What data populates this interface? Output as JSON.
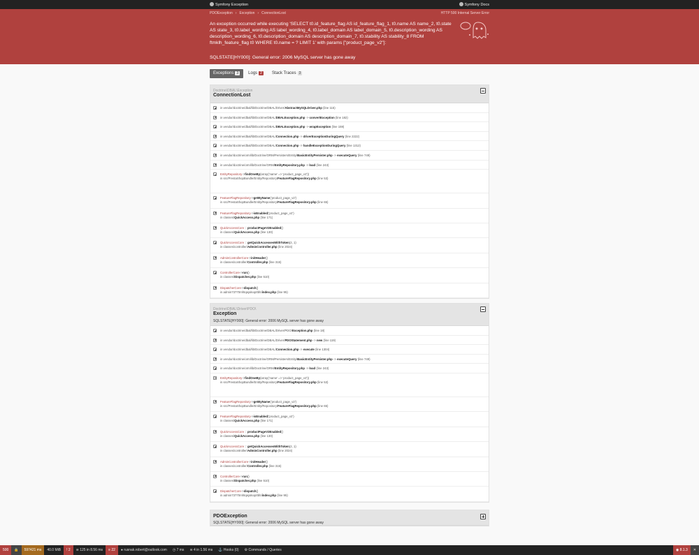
{
  "topbar": {
    "brand": "Symfony Exception",
    "docs": "Symfony Docs"
  },
  "header": {
    "crumbs": [
      "PDOException",
      "Exception",
      "ConnectionLost"
    ],
    "status": "HTTP 500 Internal Server Error",
    "message": "An exception occurred while executing 'SELECT t0.id_feature_flag AS id_feature_flag_1, t0.name AS name_2, t0.state AS state_3, t0.label_wording AS label_wording_4, t0.label_domain AS label_domain_5, t0.description_wording AS description_wording_6, t0.description_domain AS description_domain_7, t0.stability AS stability_8 FROM ftmklh_feature_flag t0 WHERE t0.name = ? LIMIT 1' with params [\"product_page_v2\"]:",
    "error": "SQLSTATE[HY000]: General error: 2006 MySQL server has gone away"
  },
  "tabs": [
    {
      "label": "Exceptions",
      "count": "3"
    },
    {
      "label": "Logs",
      "count": "2"
    },
    {
      "label": "Stack Traces",
      "count": "3"
    }
  ],
  "sections": [
    {
      "cls": "Doctrine\\DBAL\\Exception",
      "title": "ConnectionLost",
      "message": "",
      "rows": [
        {
          "kind": "vendor",
          "pre": "in vendor/doctrine/dbal/lib/Doctrine/DBAL/Driver/",
          "file": "AbstractMySQLDriver.php",
          "fn": "",
          "ln": "(line 115)"
        },
        {
          "kind": "vendor",
          "pre": "in vendor/doctrine/dbal/lib/Doctrine/DBAL/",
          "file": "DBALException.php",
          "fn": "convertException",
          "ln": "(line 182)"
        },
        {
          "kind": "vendor",
          "pre": "in vendor/doctrine/dbal/lib/Doctrine/DBAL/",
          "file": "DBALException.php",
          "fn": "wrapException",
          "ln": "(line 159)"
        },
        {
          "kind": "vendor",
          "pre": "in vendor/doctrine/dbal/lib/Doctrine/DBAL/",
          "file": "Connection.php",
          "fn": "driverExceptionDuringQuery",
          "ln": "(line 2222)"
        },
        {
          "kind": "vendor",
          "pre": "in vendor/doctrine/dbal/lib/Doctrine/DBAL/",
          "file": "Connection.php",
          "fn": "handleExceptionDuringQuery",
          "ln": "(line 1312)"
        },
        {
          "kind": "vendor",
          "pre": "in vendor/doctrine/orm/lib/Doctrine/ORM/Persisters/Entity/",
          "file": "BasicEntityPersister.php",
          "fn": "executeQuery",
          "ln": "(line 749)"
        },
        {
          "kind": "vendor",
          "pre": "in vendor/doctrine/orm/lib/Doctrine/ORM/",
          "file": "EntityRepository.php",
          "fn": "load",
          "ln": "(line 243)"
        },
        {
          "kind": "app",
          "expanded": true,
          "cls": "EntityRepository",
          "call": "findOneBy",
          "args": "(array('name' => 'product_page_v2'))",
          "pre": "in src/PrestaShopBundle/Entity/Repository/",
          "file": "FeatureFlagRepository.php",
          "ln": "(line 53)"
        },
        {
          "kind": "app",
          "cls": "FeatureFlagRepository",
          "call": "getByName",
          "args": "('product_page_v2')",
          "pre": "in src/PrestaShopBundle/Entity/Repository/",
          "file": "FeatureFlagRepository.php",
          "ln": "(line 65)"
        },
        {
          "kind": "app",
          "cls": "FeatureFlagRepository",
          "call": "isEnabled",
          "args": "('product_page_v2')",
          "pre": "in classes/",
          "file": "QuickAccess.php",
          "ln": "(line 171)"
        },
        {
          "kind": "app",
          "cls": "QuickAccessCore",
          "op": "::",
          "call": "productPageV2Enabled",
          "args": "()",
          "pre": "in classes/",
          "file": "QuickAccess.php",
          "ln": "(line 130)"
        },
        {
          "kind": "app",
          "cls": "QuickAccessCore",
          "op": "::",
          "call": "getQuickAccessesWithToken",
          "args": "(2, 1)",
          "pre": "in classes/controller/",
          "file": "AdminController.php",
          "ln": "(line 2024)"
        },
        {
          "kind": "app",
          "cls": "AdminControllerCore",
          "call": "initHeader",
          "args": "()",
          "pre": "in classes/controller/",
          "file": "Controller.php",
          "ln": "(line 315)"
        },
        {
          "kind": "app",
          "cls": "ControllerCore",
          "call": "run",
          "args": "()",
          "pre": "in classes/",
          "file": "Dispatcher.php",
          "ln": "(line 510)"
        },
        {
          "kind": "app",
          "cls": "DispatcherCore",
          "call": "dispatch",
          "args": "()",
          "pre": "in admin73770mhtqejalsop0bh/",
          "file": "index.php",
          "ln": "(line 95)"
        }
      ]
    },
    {
      "cls": "Doctrine\\DBAL\\Driver\\PDO\\",
      "title": "Exception",
      "message": "SQLSTATE[HY000]: General error: 2006 MySQL server has gone away",
      "rows": [
        {
          "kind": "vendor",
          "pre": "in vendor/doctrine/dbal/lib/Doctrine/DBAL/Driver/PDO/",
          "file": "Exception.php",
          "fn": "",
          "ln": "(line 18)"
        },
        {
          "kind": "vendor",
          "pre": "in vendor/doctrine/dbal/lib/Doctrine/DBAL/Driver/",
          "file": "PDOStatement.php",
          "fn": "new",
          "ln": "(line 119)"
        },
        {
          "kind": "vendor",
          "pre": "in vendor/doctrine/dbal/lib/Doctrine/DBAL/",
          "file": "Connection.php",
          "fn": "execute",
          "ln": "(line 1304)"
        },
        {
          "kind": "vendor",
          "pre": "in vendor/doctrine/orm/lib/Doctrine/ORM/Persisters/Entity/",
          "file": "BasicEntityPersister.php",
          "fn": "executeQuery",
          "ln": "(line 749)"
        },
        {
          "kind": "vendor",
          "pre": "in vendor/doctrine/orm/lib/Doctrine/ORM/",
          "file": "EntityRepository.php",
          "fn": "load",
          "ln": "(line 243)"
        },
        {
          "kind": "app",
          "expanded": true,
          "cls": "EntityRepository",
          "call": "findOneBy",
          "args": "(array('name' => 'product_page_v2'))",
          "pre": "in src/PrestaShopBundle/Entity/Repository/",
          "file": "FeatureFlagRepository.php",
          "ln": "(line 53)"
        },
        {
          "kind": "app",
          "cls": "FeatureFlagRepository",
          "call": "getByName",
          "args": "('product_page_v2')",
          "pre": "in src/PrestaShopBundle/Entity/Repository/",
          "file": "FeatureFlagRepository.php",
          "ln": "(line 65)"
        },
        {
          "kind": "app",
          "cls": "FeatureFlagRepository",
          "call": "isEnabled",
          "args": "('product_page_v2')",
          "pre": "in classes/",
          "file": "QuickAccess.php",
          "ln": "(line 171)"
        },
        {
          "kind": "app",
          "cls": "QuickAccessCore",
          "op": "::",
          "call": "productPageV2Enabled",
          "args": "()",
          "pre": "in classes/",
          "file": "QuickAccess.php",
          "ln": "(line 130)"
        },
        {
          "kind": "app",
          "cls": "QuickAccessCore",
          "op": "::",
          "call": "getQuickAccessesWithToken",
          "args": "(2, 1)",
          "pre": "in classes/controller/",
          "file": "AdminController.php",
          "ln": "(line 2024)"
        },
        {
          "kind": "app",
          "cls": "AdminControllerCore",
          "call": "initHeader",
          "args": "()",
          "pre": "in classes/controller/",
          "file": "Controller.php",
          "ln": "(line 315)"
        },
        {
          "kind": "app",
          "cls": "ControllerCore",
          "call": "run",
          "args": "()",
          "pre": "in classes/",
          "file": "Dispatcher.php",
          "ln": "(line 510)"
        },
        {
          "kind": "app",
          "cls": "DispatcherCore",
          "call": "dispatch",
          "args": "()",
          "pre": "in admin73770mhtqejalsop0bh/",
          "file": "index.php",
          "ln": "(line 95)"
        }
      ]
    },
    {
      "cls": "",
      "title": "PDOException",
      "message": "SQLSTATE[HY000]: General error: 2006 MySQL server has gone away",
      "collapsed": true,
      "rows": []
    }
  ],
  "toolbar": {
    "status": "500",
    "time": "597421 ms",
    "memory": "40.0 MiB",
    "errors": "2",
    "cache": "125 in 8.56 ms",
    "logs": "22",
    "user": "rusnak.robert@outlook.com",
    "exec": "7 ms",
    "db": "4 in 1.56 ms",
    "hooks": "Hooks (0)",
    "commands": "Commands / Queries",
    "version": "8.1.3"
  },
  "colors": {
    "accent": "#b0413e",
    "toolbar": "#222222"
  }
}
